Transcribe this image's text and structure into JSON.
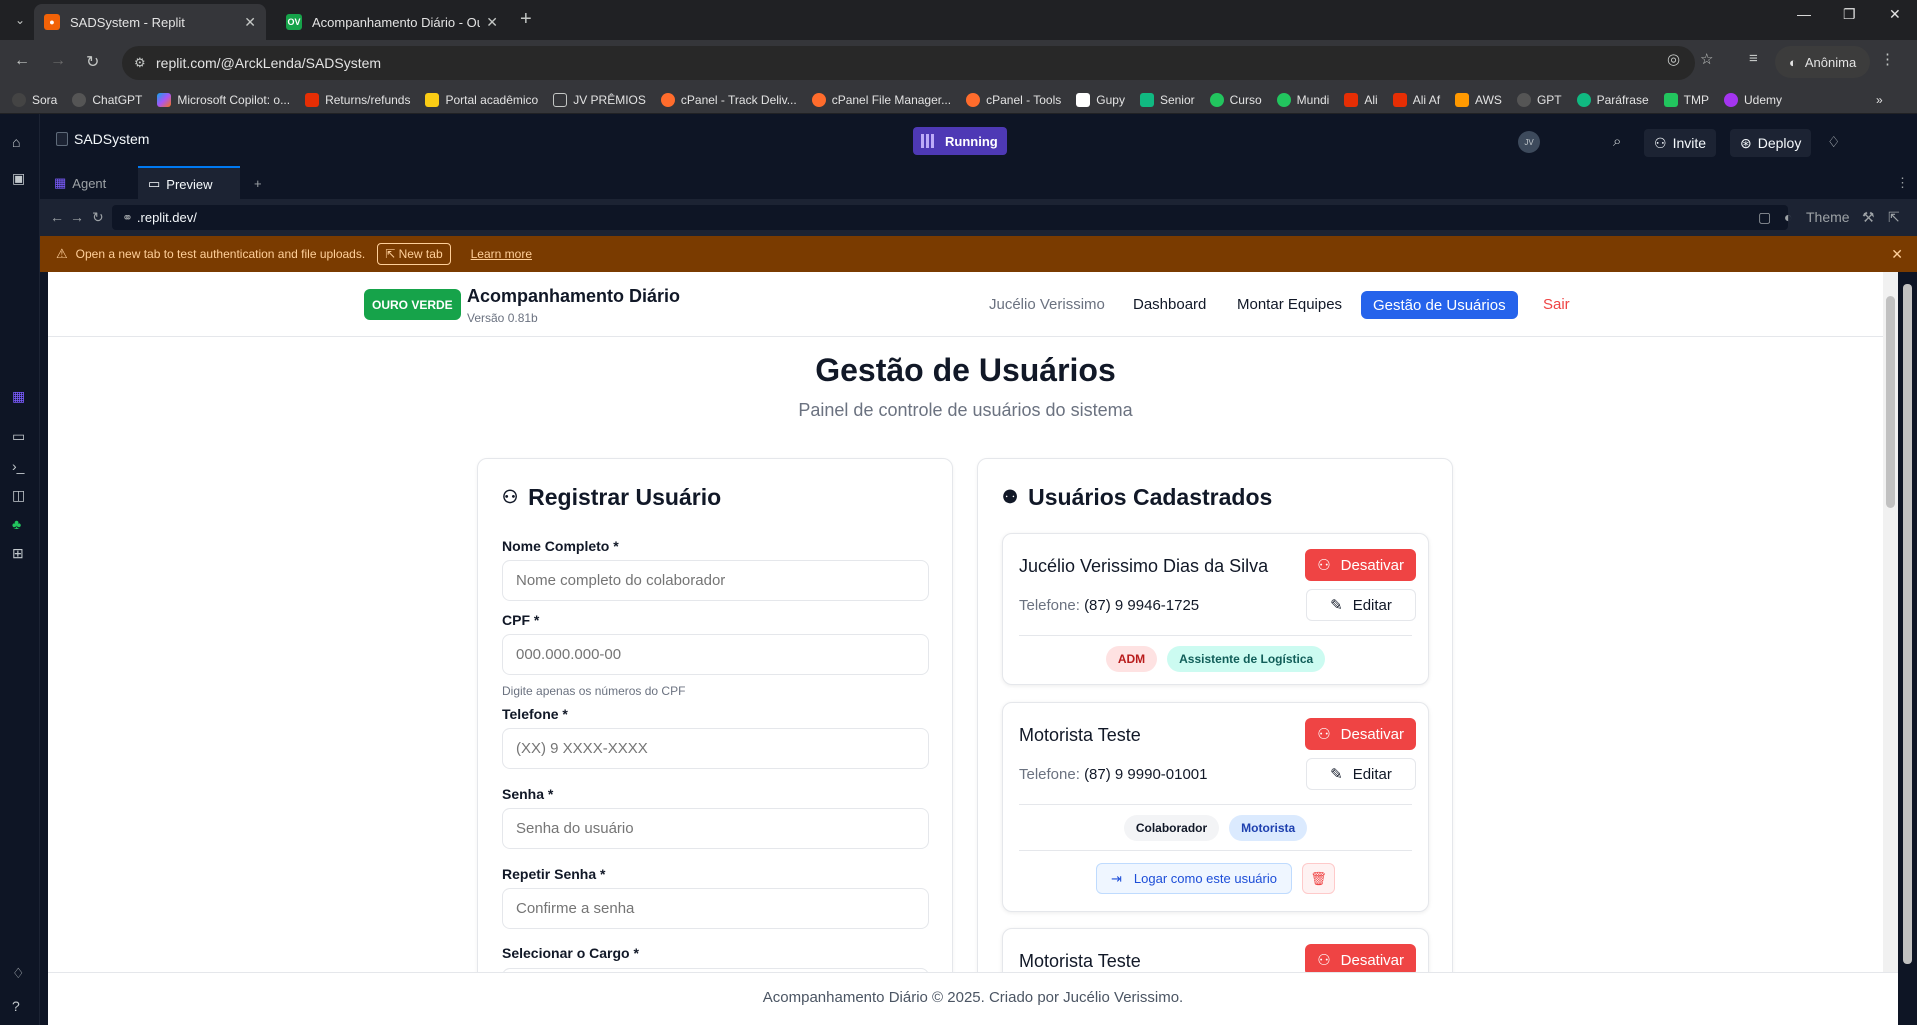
{
  "browser": {
    "tabs": [
      {
        "title": "SADSystem - Replit",
        "active": true
      },
      {
        "title": "Acompanhamento Diário - Our",
        "active": false
      }
    ],
    "url": "replit.com/@ArckLenda/SADSystem",
    "profile_label": "Anônima",
    "bookmarks": [
      "Sora",
      "ChatGPT",
      "Microsoft Copilot: o...",
      "Returns/refunds",
      "Portal acadêmico",
      "JV PRÊMIOS",
      "cPanel - Track Deliv...",
      "cPanel File Manager...",
      "cPanel - Tools",
      "Gupy",
      "Senior",
      "Curso",
      "Mundi",
      "Ali",
      "Ali Af",
      "AWS",
      "GPT",
      "Paráfrase",
      "TMP",
      "Udemy"
    ]
  },
  "replit": {
    "project_name": "SADSystem",
    "run_status": "Running",
    "invite_label": "Invite",
    "deploy_label": "Deploy",
    "avatar_initials": "JV",
    "pane_tabs": [
      "Agent",
      "Preview"
    ],
    "preview_url": ".replit.dev/",
    "theme_label": "Theme",
    "banner": {
      "message": "Open a new tab to test authentication and file uploads.",
      "new_tab_label": "New tab",
      "learn_more_label": "Learn more"
    }
  },
  "app": {
    "brand_badge": "OURO VERDE",
    "title": "Acompanhamento Diário",
    "version": "Versão 0.81b",
    "nav": {
      "user": "Jucélio Verissimo",
      "dashboard": "Dashboard",
      "teams": "Montar Equipes",
      "users": "Gestão de Usuários",
      "logout": "Sair"
    },
    "page_title": "Gestão de Usuários",
    "page_subtitle": "Painel de controle de usuários do sistema",
    "register": {
      "heading": "Registrar Usuário",
      "fields": {
        "name": {
          "label": "Nome Completo *",
          "placeholder": "Nome completo do colaborador"
        },
        "cpf": {
          "label": "CPF *",
          "placeholder": "000.000.000-00",
          "hint": "Digite apenas os números do CPF"
        },
        "phone": {
          "label": "Telefone *",
          "placeholder": "(XX) 9 XXXX-XXXX"
        },
        "password": {
          "label": "Senha *",
          "placeholder": "Senha do usuário"
        },
        "confirm": {
          "label": "Repetir Senha *",
          "placeholder": "Confirme a senha"
        },
        "role": {
          "label": "Selecionar o Cargo *"
        }
      }
    },
    "users": {
      "heading": "Usuários Cadastrados",
      "phone_prefix": "Telefone:",
      "deactivate_label": "Desativar",
      "edit_label": "Editar",
      "login_as_label": "Logar como este usuário",
      "list": [
        {
          "name": "Jucélio Verissimo Dias da Silva",
          "phone": "(87) 9 9946-1725",
          "badges": [
            "ADM",
            "Assistente de Logística"
          ]
        },
        {
          "name": "Motorista Teste",
          "phone": "(87) 9 9990-01001",
          "badges": [
            "Colaborador",
            "Motorista"
          ]
        },
        {
          "name": "Motorista Teste"
        }
      ]
    },
    "footer": "Acompanhamento Diário © 2025. Criado por Jucélio Verissimo."
  },
  "colors": {
    "primary": "#2563eb",
    "danger": "#ef4444",
    "brand_green": "#16a34a",
    "replit_running": "#4e39b5",
    "banner_bg": "#7a3b00"
  }
}
